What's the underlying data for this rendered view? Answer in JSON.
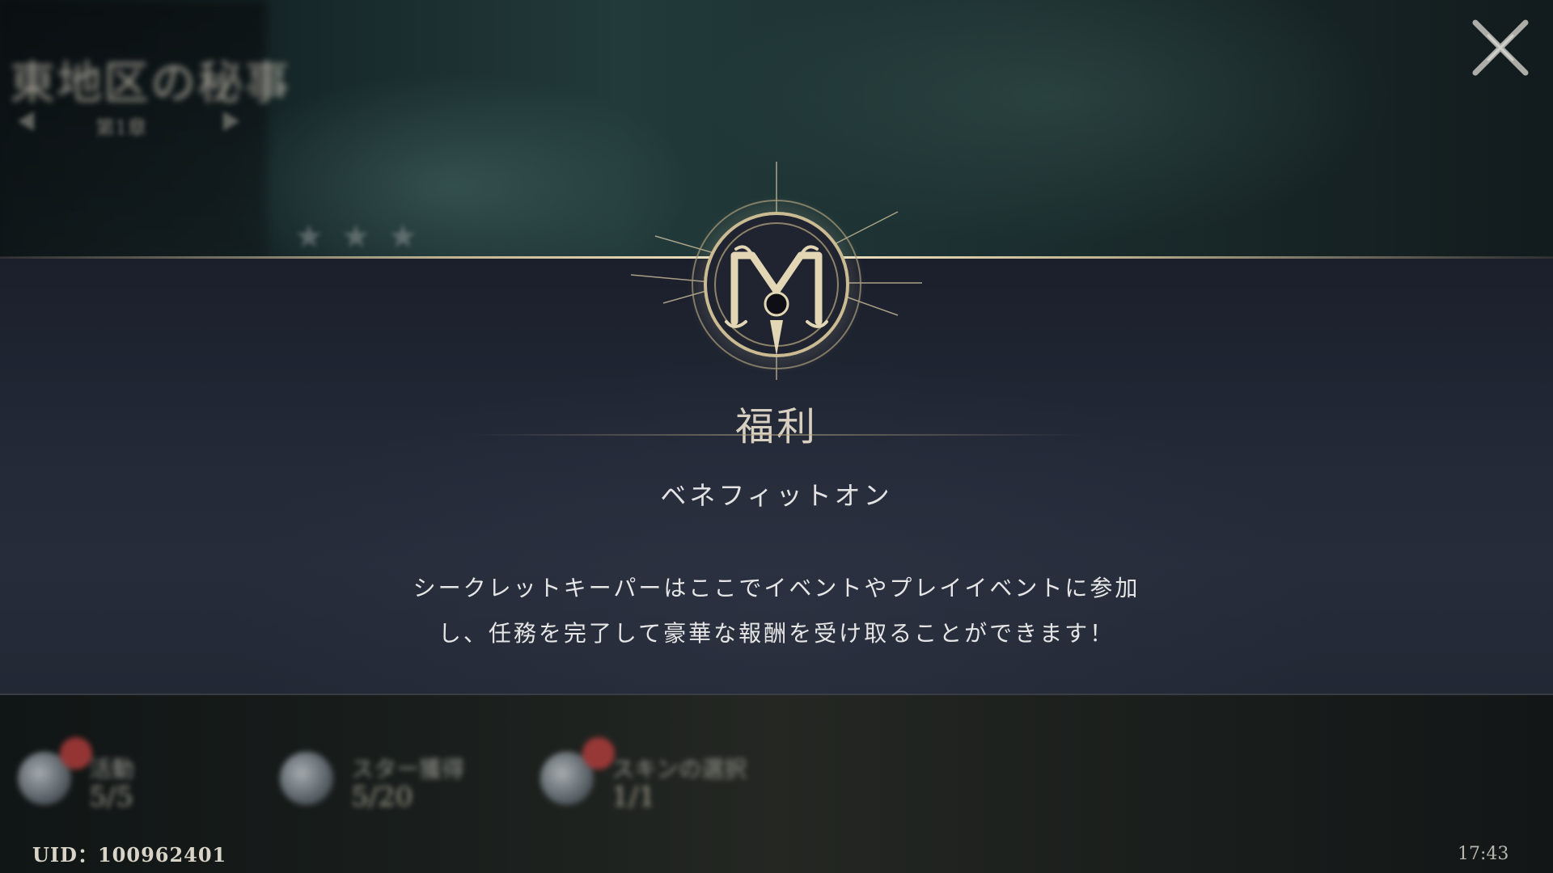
{
  "background": {
    "location_title": "東地区の秘事",
    "location_subtitle": "第1章",
    "stars": [
      "★",
      "★",
      "★"
    ]
  },
  "modal": {
    "title": "福利",
    "subtitle": "ベネフィットオン",
    "description_line1": "シークレットキーパーはここでイベントやプレイイベントに参加",
    "description_line2": "し、任務を完了して豪華な報酬を受け取ることができます！",
    "emblem_icon": "monogram-m-emblem-icon",
    "close_icon": "close-x-icon"
  },
  "bottom_menu": {
    "items": [
      {
        "label": "活動",
        "count": "5/5",
        "icon": "gift-icon",
        "badge": true
      },
      {
        "label": "スター獲得",
        "count": "5/20",
        "icon": "star-icon",
        "badge": false
      },
      {
        "label": "スキンの選択",
        "count": "1/1",
        "icon": "trophy-icon",
        "badge": true
      }
    ]
  },
  "footer": {
    "uid": "UID：100962401",
    "clock": "17:43"
  },
  "colors": {
    "accent_gold": "#d7c9a3",
    "modal_bg": "#232937",
    "badge_red": "#c0403f"
  }
}
